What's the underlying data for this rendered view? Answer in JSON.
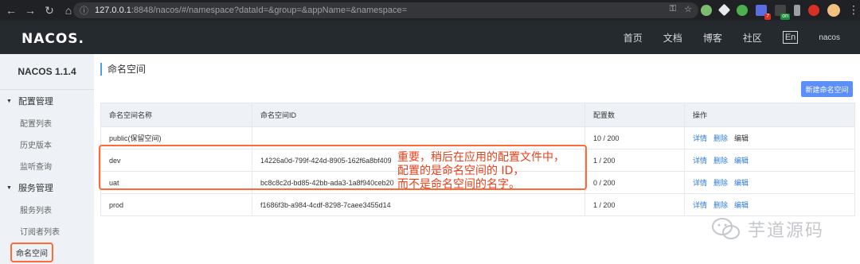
{
  "browser": {
    "back_icon": "arrow-left-icon",
    "forward_icon": "arrow-right-icon",
    "reload_icon": "reload-icon",
    "home_icon": "home-icon",
    "url_host": "127.0.0.1",
    "url_rest": ":8848/nacos/#/namespace?dataId=&group=&appName=&namespace=",
    "ext_badge_1": "7",
    "ext_badge_2": "on"
  },
  "header": {
    "logo": "NACOS.",
    "nav": [
      "首页",
      "文档",
      "博客",
      "社区"
    ],
    "lang": "En",
    "user": "nacos"
  },
  "sidebar": {
    "version": "NACOS 1.1.4",
    "groups": [
      {
        "title": "配置管理",
        "items": [
          "配置列表",
          "历史版本",
          "监听查询"
        ]
      },
      {
        "title": "服务管理",
        "items": [
          "服务列表",
          "订阅者列表"
        ]
      }
    ],
    "active_item": "命名空间"
  },
  "main": {
    "title": "命名空间",
    "new_button": "新建命名空间",
    "columns": [
      "命名空间名称",
      "命名空间ID",
      "配置数",
      "操作"
    ],
    "rows": [
      {
        "name": "public(保留空间)",
        "id": "",
        "count": "10 / 200",
        "ops": [
          "详情",
          "删除",
          "编辑"
        ]
      },
      {
        "name": "dev",
        "id": "14226a0d-799f-424d-8905-162f6a8bf409",
        "count": "1 / 200",
        "ops": [
          "详情",
          "删除",
          "编辑"
        ]
      },
      {
        "name": "uat",
        "id": "bc8c8c2d-bd85-42bb-ada3-1a8f940ceb20",
        "count": "0 / 200",
        "ops": [
          "详情",
          "删除",
          "编辑"
        ]
      },
      {
        "name": "prod",
        "id": "f1686f3b-a984-4cdf-8298-7caee3455d14",
        "count": "1 / 200",
        "ops": [
          "详情",
          "删除",
          "编辑"
        ]
      }
    ]
  },
  "annotation": {
    "lines": [
      "重要，稍后在应用的配置文件中，",
      "配置的是命名空间的 ID，",
      "而不是命名空间的名字。"
    ]
  },
  "watermark": {
    "text": "芋道源码"
  },
  "colors": {
    "topbar": "#252a2f",
    "sidebar": "#eef1f5",
    "primary": "#5b8ff9",
    "link": "#2f7bd8",
    "annotation": "#ff6b35"
  }
}
